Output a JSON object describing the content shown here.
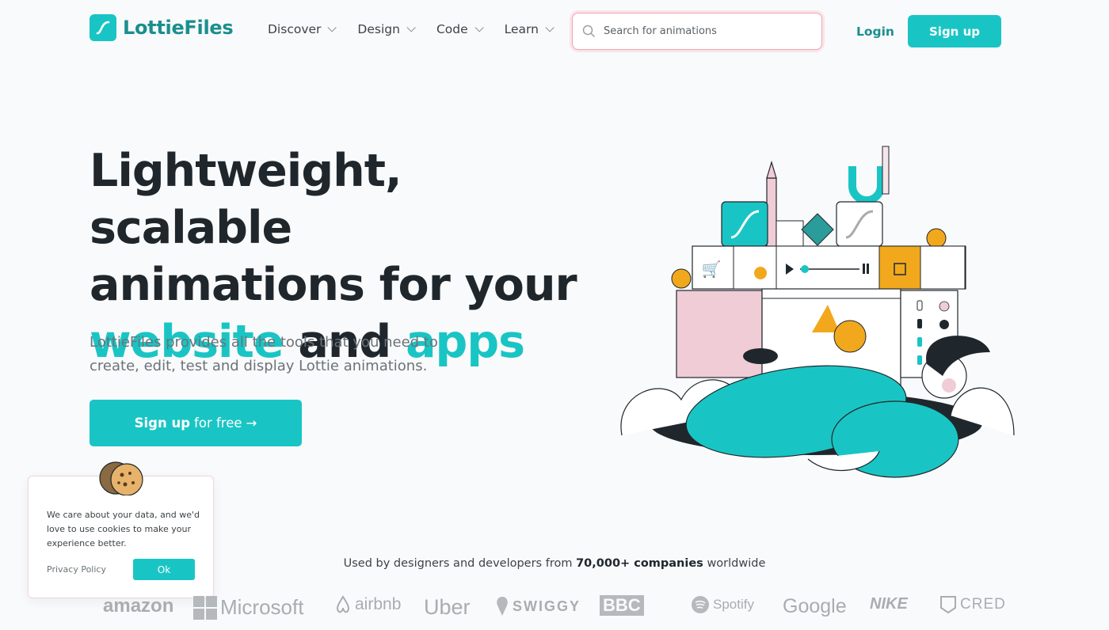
{
  "header": {
    "logo_text": "LottieFiles",
    "nav": [
      {
        "label": "Discover"
      },
      {
        "label": "Design"
      },
      {
        "label": "Code"
      },
      {
        "label": "Learn"
      }
    ],
    "search_placeholder": "Search for animations",
    "login_label": "Login",
    "signup_label": "Sign up"
  },
  "hero": {
    "title_line1": "Lightweight, scalable",
    "title_line2": "animations for your",
    "title_word_website": "website",
    "title_word_and": "and",
    "title_word_apps": "apps",
    "subtitle": "LottieFiles provides all the tools that you need to create, edit, test and display Lottie animations.",
    "cta_strong": "Sign up",
    "cta_rest": "for free",
    "cta_arrow": "→"
  },
  "cookie": {
    "text": "We care about your data, and we'd love to use cookies to make your experience better.",
    "privacy_label": "Privacy Policy",
    "ok_label": "Ok"
  },
  "used_by": {
    "prefix": "Used by designers and developers from",
    "highlight": "70,000+ companies",
    "suffix": "worldwide"
  },
  "brands": [
    "amazon",
    "Microsoft",
    "airbnb",
    "Uber",
    "SWIGGY",
    "BBC",
    "Spotify",
    "Google",
    "NIKE",
    "CRED"
  ],
  "colors": {
    "accent": "#19c5c4",
    "accent_dark": "#1a8f8e",
    "text": "#20272c",
    "orange": "#f2a81d",
    "pink": "#f0ccd6"
  }
}
